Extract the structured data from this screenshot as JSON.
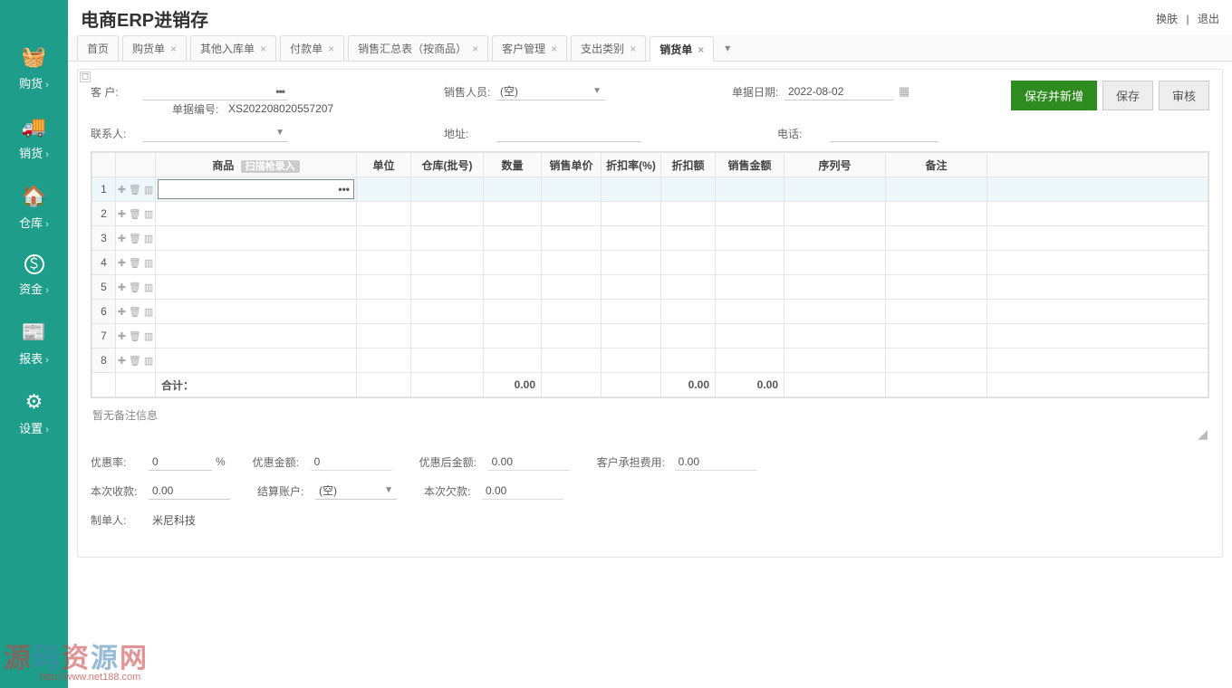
{
  "header": {
    "title": "电商ERP进销存",
    "switch": "换肤",
    "logout": "退出"
  },
  "sidebar": {
    "items": [
      {
        "icon": "🧺",
        "label": "购货"
      },
      {
        "icon": "🚚",
        "label": "销货"
      },
      {
        "icon": "🏠",
        "label": "仓库"
      },
      {
        "icon": "＄",
        "label": "资金"
      },
      {
        "icon": "📰",
        "label": "报表"
      },
      {
        "icon": "⚙",
        "label": "设置"
      }
    ]
  },
  "tabs": {
    "items": [
      {
        "label": "首页",
        "closable": false
      },
      {
        "label": "购货单",
        "closable": true
      },
      {
        "label": "其他入库单",
        "closable": true
      },
      {
        "label": "付款单",
        "closable": true
      },
      {
        "label": "销售汇总表（按商品）",
        "closable": true
      },
      {
        "label": "客户管理",
        "closable": true
      },
      {
        "label": "支出类别",
        "closable": true
      },
      {
        "label": "销货单",
        "closable": true,
        "active": true
      }
    ]
  },
  "toolbar": {
    "save_new": "保存并新增",
    "save": "保存",
    "audit": "审核"
  },
  "form": {
    "customer_label": "客  户:",
    "salesperson_label": "销售人员:",
    "salesperson_value": "(空)",
    "date_label": "单据日期:",
    "date_value": "2022-08-02",
    "docno_label": "单据编号:",
    "docno_value": "XS202208020557207",
    "contact_label": "联系人:",
    "address_label": "地址:",
    "phone_label": "电话:"
  },
  "grid": {
    "columns": {
      "product": "商品",
      "scan": "扫描枪录入",
      "unit": "单位",
      "warehouse": "仓库(批号)",
      "qty": "数量",
      "price": "销售单价",
      "discount_rate": "折扣率(%)",
      "discount_amt": "折扣额",
      "amount": "销售金额",
      "serial": "序列号",
      "remark": "备注"
    },
    "row_count": 8,
    "footer": {
      "label": "合计：",
      "qty": "0.00",
      "discount_amt": "0.00",
      "amount": "0.00"
    }
  },
  "note": "暂无备注信息",
  "bottom": {
    "disc_rate_label": "优惠率:",
    "disc_rate_value": "0",
    "percent": "%",
    "disc_amt_label": "优惠金额:",
    "disc_amt_value": "0",
    "after_label": "优惠后金额:",
    "after_value": "0.00",
    "cust_fee_label": "客户承担费用:",
    "cust_fee_value": "0.00",
    "pay_label": "本次收款:",
    "pay_value": "0.00",
    "acct_label": "结算账户:",
    "acct_value": "(空)",
    "owe_label": "本次欠款:",
    "owe_value": "0.00",
    "maker_label": "制单人:",
    "maker_value": "米尼科技"
  },
  "watermark": {
    "text": "源码资源网",
    "url": "http://www.net188.com"
  }
}
